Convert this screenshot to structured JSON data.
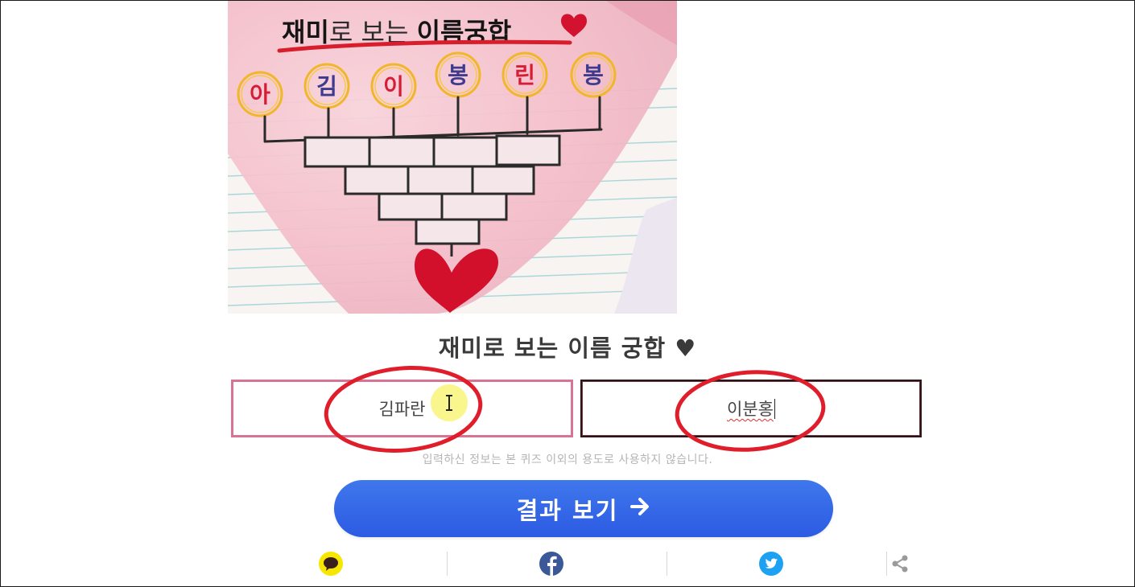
{
  "hero": {
    "headline": "재미로 보는 이름궁합",
    "name_letters": [
      "아",
      "김",
      "이",
      "봉",
      "린",
      "봉"
    ]
  },
  "form": {
    "title": "재미로 보는 이름 궁합",
    "title_icon": "black-heart-icon",
    "name1_value": "김파란",
    "name2_value": "이분홍",
    "notice": "입력하신 정보는 본 퀴즈 이외의 용도로 사용하지 않습니다.",
    "submit_label": "결과 보기",
    "submit_icon": "arrow-right-icon"
  },
  "share": {
    "items": [
      {
        "icon": "kakaotalk-icon",
        "color": "#f7e600"
      },
      {
        "icon": "facebook-icon",
        "color": "#3b5998"
      },
      {
        "icon": "twitter-icon",
        "color": "#1da1f2"
      },
      {
        "icon": "share-icon",
        "color": "#9a9a9a"
      }
    ]
  },
  "colors": {
    "cta": "#2f62e6",
    "annotation_red": "#e01e2b",
    "left_border": "#d77493"
  }
}
